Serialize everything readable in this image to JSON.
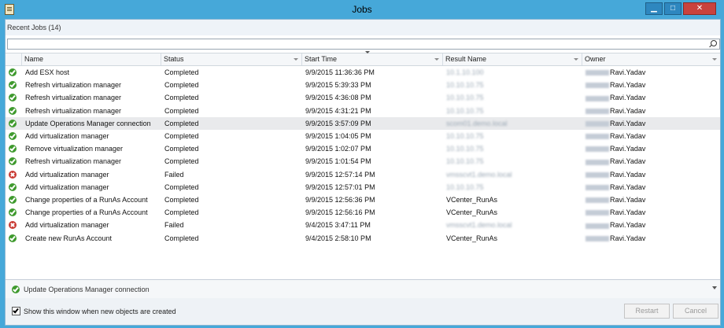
{
  "window": {
    "title": "Jobs",
    "minimize": "▁",
    "maximize": "□",
    "close": "✕"
  },
  "header": {
    "recent_jobs": "Recent Jobs (14)"
  },
  "search": {
    "value": "",
    "placeholder": ""
  },
  "columns": [
    "Name",
    "Status",
    "Start Time",
    "Result Name",
    "Owner"
  ],
  "rows": [
    {
      "status_icon": "success-icon",
      "name": "Add ESX host",
      "status": "Completed",
      "start_time": "9/9/2015 11:36:36 PM",
      "result_name": "10.1.10.100",
      "result_blurred": true,
      "owner": "Ravi.Yadav"
    },
    {
      "status_icon": "success-icon",
      "name": "Refresh virtualization manager",
      "status": "Completed",
      "start_time": "9/9/2015 5:39:33 PM",
      "result_name": "10.10.10.75",
      "result_blurred": true,
      "owner": "Ravi.Yadav"
    },
    {
      "status_icon": "success-icon",
      "name": "Refresh virtualization manager",
      "status": "Completed",
      "start_time": "9/9/2015 4:36:08 PM",
      "result_name": "10.10.10.75",
      "result_blurred": true,
      "owner": "Ravi.Yadav"
    },
    {
      "status_icon": "success-icon",
      "name": "Refresh virtualization manager",
      "status": "Completed",
      "start_time": "9/9/2015 4:31:21 PM",
      "result_name": "10.10.10.75",
      "result_blurred": true,
      "owner": "Ravi.Yadav"
    },
    {
      "status_icon": "success-icon",
      "name": "Update Operations Manager connection",
      "status": "Completed",
      "start_time": "9/9/2015 3:57:09 PM",
      "result_name": "scom01.demo.local",
      "result_blurred": true,
      "owner": "Ravi.Yadav"
    },
    {
      "status_icon": "success-icon",
      "name": "Add virtualization manager",
      "status": "Completed",
      "start_time": "9/9/2015 1:04:05 PM",
      "result_name": "10.10.10.75",
      "result_blurred": true,
      "owner": "Ravi.Yadav"
    },
    {
      "status_icon": "success-icon",
      "name": "Remove virtualization manager",
      "status": "Completed",
      "start_time": "9/9/2015 1:02:07 PM",
      "result_name": "10.10.10.75",
      "result_blurred": true,
      "owner": "Ravi.Yadav"
    },
    {
      "status_icon": "success-icon",
      "name": "Refresh virtualization manager",
      "status": "Completed",
      "start_time": "9/9/2015 1:01:54 PM",
      "result_name": "10.10.10.75",
      "result_blurred": true,
      "owner": "Ravi.Yadav"
    },
    {
      "status_icon": "failed-icon",
      "name": "Add virtualization manager",
      "status": "Failed",
      "start_time": "9/9/2015 12:57:14 PM",
      "result_name": "vmsscvt1.demo.local",
      "result_blurred": true,
      "owner": "Ravi.Yadav"
    },
    {
      "status_icon": "success-icon",
      "name": "Add virtualization manager",
      "status": "Completed",
      "start_time": "9/9/2015 12:57:01 PM",
      "result_name": "10.10.10.75",
      "result_blurred": true,
      "owner": "Ravi.Yadav"
    },
    {
      "status_icon": "success-icon",
      "name": "Change properties of a RunAs Account",
      "status": "Completed",
      "start_time": "9/9/2015 12:56:36 PM",
      "result_name": "VCenter_RunAs",
      "result_blurred": false,
      "owner": "Ravi.Yadav"
    },
    {
      "status_icon": "success-icon",
      "name": "Change properties of a RunAs Account",
      "status": "Completed",
      "start_time": "9/9/2015 12:56:16 PM",
      "result_name": "VCenter_RunAs",
      "result_blurred": false,
      "owner": "Ravi.Yadav"
    },
    {
      "status_icon": "failed-icon",
      "name": "Add virtualization manager",
      "status": "Failed",
      "start_time": "9/4/2015 3:47:11 PM",
      "result_name": "vmsscvt1.demo.local",
      "result_blurred": true,
      "owner": "Ravi.Yadav"
    },
    {
      "status_icon": "success-icon",
      "name": "Create new RunAs Account",
      "status": "Completed",
      "start_time": "9/4/2015 2:58:10 PM",
      "result_name": "VCenter_RunAs",
      "result_blurred": false,
      "owner": "Ravi.Yadav"
    }
  ],
  "selected_row": 4,
  "detail": {
    "status_icon": "success-icon",
    "label": "Update Operations Manager connection"
  },
  "footer": {
    "show_window_label": "Show this window when new objects are created",
    "show_window_checked": true,
    "restart_label": "Restart",
    "cancel_label": "Cancel"
  },
  "colors": {
    "title_bar": "#46a8d9",
    "success": "#3f9a2e",
    "failed": "#c93a33",
    "close_button": "#c9423d"
  }
}
